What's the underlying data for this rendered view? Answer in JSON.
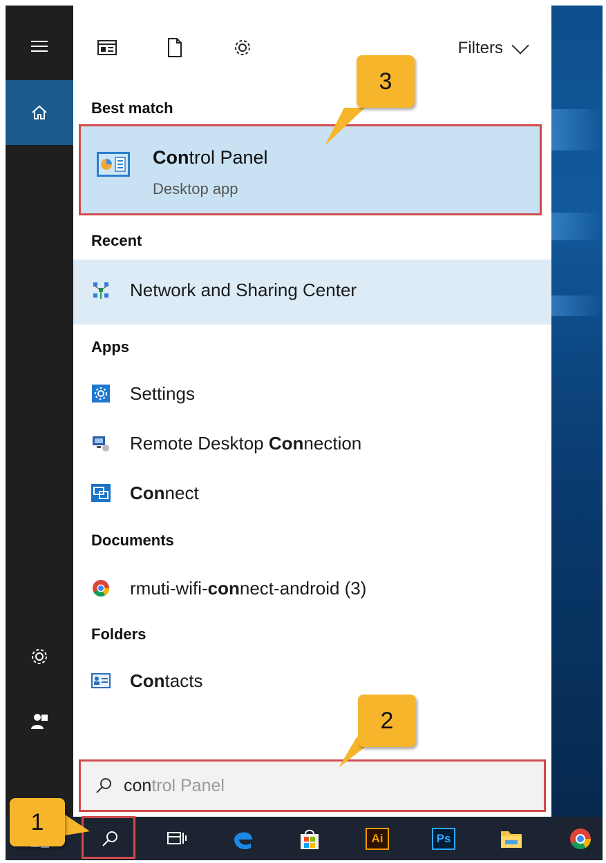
{
  "toolbar": {
    "filters_label": "Filters"
  },
  "best_match": {
    "header": "Best match",
    "title_bold": "Con",
    "title_rest": "trol Panel",
    "subtitle": "Desktop app"
  },
  "recent": {
    "header": "Recent",
    "item": "Network and Sharing Center"
  },
  "apps": {
    "header": "Apps",
    "settings": "Settings",
    "rdc_pre": "Remote Desktop ",
    "rdc_bold": "Con",
    "rdc_post": "nection",
    "connect_bold": "Con",
    "connect_post": "nect"
  },
  "documents": {
    "header": "Documents",
    "item_pre": "rmuti-wifi-",
    "item_bold": "con",
    "item_post": "nect-android (3)"
  },
  "folders": {
    "header": "Folders",
    "item_bold": "Con",
    "item_post": "tacts"
  },
  "search": {
    "typed": "con",
    "ghost": "trol Panel"
  },
  "taskbar": {
    "ai_label": "Ai",
    "ps_label": "Ps"
  },
  "callouts": {
    "one": "1",
    "two": "2",
    "three": "3"
  },
  "colors": {
    "accent_blue": "#1d5a8c",
    "best_match_bg": "#c8e1f3",
    "highlight_red": "#d24a4a",
    "callout_yellow": "#f7b52c"
  }
}
